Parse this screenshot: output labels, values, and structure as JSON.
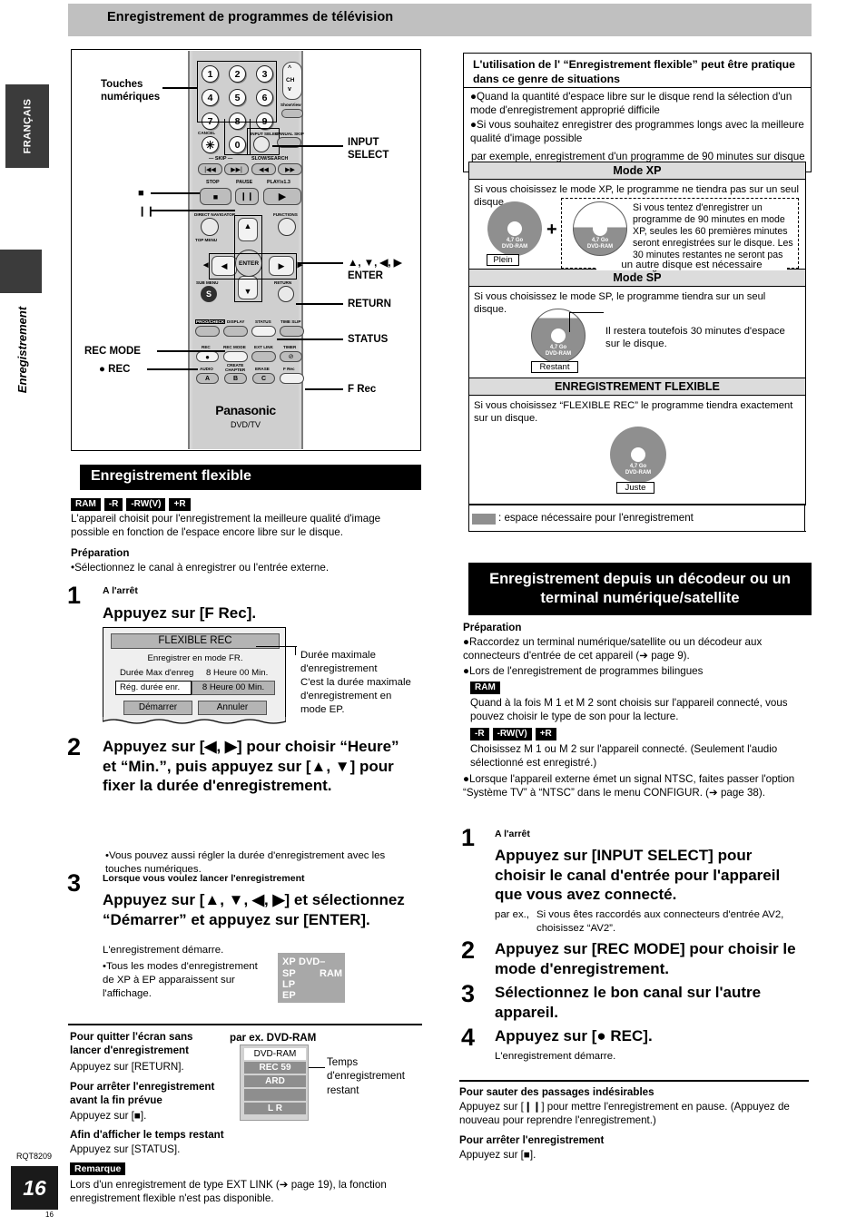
{
  "sidebar": {
    "language_tab": "FRANÇAIS",
    "section_tab": "Enregistrement"
  },
  "header": {
    "title": "Enregistrement de programmes de télévision"
  },
  "remote": {
    "brand": "Panasonic",
    "brand_sub": "DVD/TV",
    "callouts": {
      "numeric_keys": "Touches\nnumériques",
      "input_select": "INPUT\nSELECT",
      "arrows_enter": "▲, ▼, ◀, ▶\nENTER",
      "return": "RETURN",
      "status": "STATUS",
      "rec_mode": "REC MODE",
      "rec": "● REC",
      "f_rec": "F Rec"
    },
    "keys": {
      "n1": "1",
      "n2": "2",
      "n3": "3",
      "n4": "4",
      "n5": "5",
      "n6": "6",
      "n7": "7",
      "n8": "8",
      "n9": "9",
      "n0": "0",
      "cancel": "CANCEL",
      "asterisk": "✳",
      "ch": "CH",
      "showview": "ShowView",
      "input_select": "INPUT SELECT",
      "manual_skip": "MANUAL SKIP",
      "skip": "SKIP",
      "slowsearch": "SLOW/SEARCH",
      "stop": "STOP",
      "pause": "PAUSE",
      "play": "PLAY/x1.3",
      "direct_navigator": "DIRECT NAVIGATOR",
      "top_menu": "TOP MENU",
      "functions": "FUNCTIONS",
      "enter": "ENTER",
      "sub_menu": "SUB MENU",
      "sub_menu_glyph": "S",
      "return": "RETURN",
      "prog_check": "PROG/CHECK",
      "display": "DISPLAY",
      "status": "STATUS",
      "time_slip": "TIME SLIP",
      "rec": "REC",
      "rec_mode": "REC MODE",
      "ext_link": "EXT LINK",
      "timer": "TIMER",
      "audio": "AUDIO",
      "audio_glyph": "A",
      "create_chapter": "CREATE\nCHAPTER",
      "create_chapter_glyph": "B",
      "erase": "ERASE",
      "erase_glyph": "C",
      "f_rec": "F Rec"
    }
  },
  "flexible_section": {
    "heading": "Enregistrement flexible",
    "badges": [
      "RAM",
      "-R",
      "-RW(V)",
      "+R"
    ],
    "intro": "L'appareil choisit pour l'enregistrement la meilleure qualité d'image possible en fonction de l'espace encore libre sur le disque.",
    "prep_title": "Préparation",
    "prep_item": "Sélectionnez le canal à enregistrer ou l'entrée externe.",
    "steps": [
      {
        "num": "1",
        "sub": "A l'arrêt",
        "main": "Appuyez sur [F Rec].",
        "note": ""
      },
      {
        "num": "2",
        "sub": "",
        "main": "Appuyez sur [◀, ▶] pour choisir “Heure” et “Min.”, puis appuyez sur [▲, ▼] pour fixer la durée d'enregistrement.",
        "note": "Vous pouvez aussi régler la durée d'enregistrement avec les touches numériques."
      },
      {
        "num": "3",
        "sub": "Lorsque vous voulez lancer l'enregistrement",
        "main": "Appuyez sur [▲, ▼, ◀, ▶] et sélectionnez “Démarrer” et appuyez sur [ENTER].",
        "note": "L'enregistrement démarre.",
        "bullet": "Tous les modes d'enregistrement de XP à EP apparaissent sur l'affichage."
      }
    ],
    "osd": {
      "title": "FLEXIBLE REC",
      "subtitle": "Enregistrer en mode FR.",
      "max_label": "Durée Max d'enreg",
      "max_value": "8 Heure 00 Min.",
      "set_label": "Rég. durée enr.",
      "set_value": "8 Heure 00 Min.",
      "start_button": "Démarrer",
      "cancel_button": "Annuler"
    },
    "osd_callout": "Durée maximale d'enregistrement\nC'est la durée maximale d'enregistrement en mode EP.",
    "mode_display": {
      "xp": "XP",
      "sp": "SP",
      "lp": "LP",
      "ep": "EP",
      "dvd": "DVD–",
      "ram": "RAM"
    },
    "tips": [
      {
        "title": "Pour quitter l'écran sans lancer d'enregistrement",
        "text": "Appuyez sur [RETURN]."
      },
      {
        "title": "Pour arrêter l'enregistrement avant la fin prévue",
        "text": "Appuyez sur [■]."
      },
      {
        "title": "Afin d'afficher le temps restant",
        "text": "Appuyez sur [STATUS]."
      }
    ],
    "ram_example": {
      "caption": "par ex. DVD-RAM",
      "line1": "DVD-RAM",
      "line2": "REC 59",
      "line3": "ARD",
      "line4": "",
      "line5": "L R",
      "callout": "Temps d'enregistrement restant"
    },
    "remark_label": "Remarque",
    "remark_text": "Lors d'un enregistrement de type EXT LINK (➔ page 19), la fonction enregistrement flexible n'est pas disponible."
  },
  "tipbox": {
    "heading": "L'utilisation de l' “Enregistrement flexible” peut être pratique dans ce genre de situations",
    "items": [
      "Quand la quantité d'espace libre sur le disque rend la sélection d'un mode d'enregistrement approprié difficile",
      "Si vous souhaitez enregistrer des programmes longs avec la meilleure qualité d'image possible"
    ],
    "example": "par exemple, enregistrement d'un programme de 90 minutes sur disque"
  },
  "mode_table": {
    "xp": {
      "header": "Mode XP",
      "text": "Si vous choisissez le mode XP, le programme ne tiendra pas sur un seul disque.",
      "disc1_label": "4,7 Go\nDVD-RAM",
      "disc1_tag": "Plein",
      "plus": "+",
      "disc2_label": "4,7 Go\nDVD-RAM",
      "note": "Si vous tentez d'enregistrer un programme de 90 minutes en mode XP, seules les 60 premières minutes seront enregistrées sur le disque. Les 30 minutes restantes ne seront pas enregistrées.",
      "dash_caption": "un autre disque est nécessaire"
    },
    "sp": {
      "header": "Mode SP",
      "text": "Si vous choisissez le mode SP, le programme tiendra sur un seul disque.",
      "disc_label": "4,7 Go\nDVD-RAM",
      "disc_tag": "Restant",
      "note": "Il restera toutefois 30 minutes d'espace sur le disque."
    },
    "flex": {
      "header": "ENREGISTREMENT FLEXIBLE",
      "text": "Si vous choisissez “FLEXIBLE REC” le programme tiendra exactement sur un disque.",
      "disc_label": "4,7 Go\nDVD-RAM",
      "disc_tag": "Juste"
    },
    "legend": ": espace nécessaire pour l'enregistrement"
  },
  "decoder_section": {
    "heading": "Enregistrement depuis un décodeur ou un terminal numérique/satellite",
    "prep_title": "Préparation",
    "prep_items": [
      "Raccordez un terminal numérique/satellite ou un décodeur aux connecteurs d'entrée de cet appareil (➔ page 9).",
      "Lors de l'enregistrement de programmes bilingues"
    ],
    "ram_badge": "RAM",
    "ram_text": "Quand à la fois M 1 et M 2 sont choisis sur l'appareil connecté, vous pouvez choisir le type de son pour la lecture.",
    "disc_badges": [
      "-R",
      "-RW(V)",
      "+R"
    ],
    "disc_text": "Choisissez M 1 ou M 2 sur l'appareil connecté. (Seulement l'audio sélectionné est enregistré.)",
    "ntsc_item": "Lorsque l'appareil externe émet un signal NTSC, faites passer l'option “Système TV” à “NTSC” dans le menu CONFIGUR. (➔ page 38).",
    "steps": [
      {
        "num": "1",
        "sub": "A l'arrêt",
        "main": "Appuyez sur [INPUT SELECT] pour choisir le canal d'entrée pour l'appareil que vous avez connecté.",
        "note_label": "par ex.,",
        "note": "Si vous êtes raccordés aux connecteurs d'entrée AV2, choisissez “AV2”."
      },
      {
        "num": "2",
        "sub": "",
        "main": "Appuyez sur [REC MODE] pour choisir le mode d'enregistrement.",
        "note": ""
      },
      {
        "num": "3",
        "sub": "",
        "main": "Sélectionnez le bon canal sur l'autre appareil.",
        "note": ""
      },
      {
        "num": "4",
        "sub": "",
        "main": "Appuyez sur [● REC].",
        "note": "L'enregistrement démarre."
      }
    ],
    "tips": [
      {
        "title": "Pour sauter des passages indésirables",
        "text": "Appuyez sur [❙❙] pour mettre l'enregistrement en pause. (Appuyez de nouveau pour reprendre l'enregistrement.)"
      },
      {
        "title": "Pour arrêter l'enregistrement",
        "text": "Appuyez sur [■]."
      }
    ]
  },
  "footer": {
    "rqt": "RQT8209",
    "page": "16",
    "page_small": "16"
  }
}
